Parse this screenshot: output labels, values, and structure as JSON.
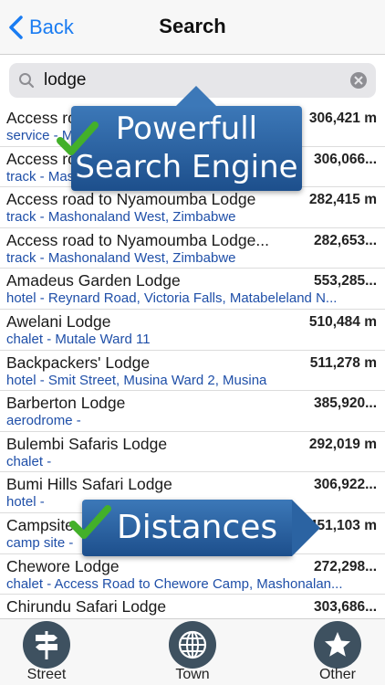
{
  "nav": {
    "back_label": "Back",
    "title": "Search"
  },
  "search": {
    "value": "lodge"
  },
  "results": [
    {
      "name": "Access road to Nyamoumba Lodge",
      "sub": "service - Mashonaland West, Zimbabwe",
      "dist": "306,421 m"
    },
    {
      "name": "Access road to Nyamoumba Lodge",
      "sub": "track - Mashonaland West, Zimbabwe",
      "dist": "306,066..."
    },
    {
      "name": "Access road to Nyamoumba Lodge",
      "sub": "track - Mashonaland West, Zimbabwe",
      "dist": "282,415 m"
    },
    {
      "name": "Access road to Nyamoumba Lodge...",
      "sub": "track - Mashonaland West, Zimbabwe",
      "dist": "282,653..."
    },
    {
      "name": "Amadeus Garden Lodge",
      "sub": "hotel - Reynard Road, Victoria Falls, Matabeleland N...",
      "dist": "553,285..."
    },
    {
      "name": "Awelani Lodge",
      "sub": "chalet - Mutale Ward 11",
      "dist": "510,484 m"
    },
    {
      "name": "Backpackers' Lodge",
      "sub": "hotel - Smit Street, Musina Ward 2, Musina",
      "dist": "511,278 m"
    },
    {
      "name": "Barberton Lodge",
      "sub": "aerodrome -",
      "dist": "385,920..."
    },
    {
      "name": "Bulembi Safaris Lodge",
      "sub": "chalet -",
      "dist": "292,019 m"
    },
    {
      "name": "Bumi Hills Safari Lodge",
      "sub": "hotel -",
      "dist": "306,922..."
    },
    {
      "name": "Campsite",
      "sub": "camp site -",
      "dist": "451,103 m"
    },
    {
      "name": "Chewore Lodge",
      "sub": "chalet - Access Road to Chewore Camp, Mashonalan...",
      "dist": "272,298..."
    },
    {
      "name": "Chirundu Safari Lodge",
      "sub": "",
      "dist": "303,686..."
    }
  ],
  "callouts": {
    "search_line1": "Powerfull",
    "search_line2": "Search Engine",
    "distances": "Distances"
  },
  "tabs": {
    "street": "Street",
    "town": "Town",
    "other": "Other"
  },
  "colors": {
    "accent_blue": "#1a7cf2",
    "subtitle_blue": "#1f4fa8",
    "callout_blue": "#2b63a2",
    "check_green": "#43b02a",
    "tab_icon": "#3e5160"
  }
}
